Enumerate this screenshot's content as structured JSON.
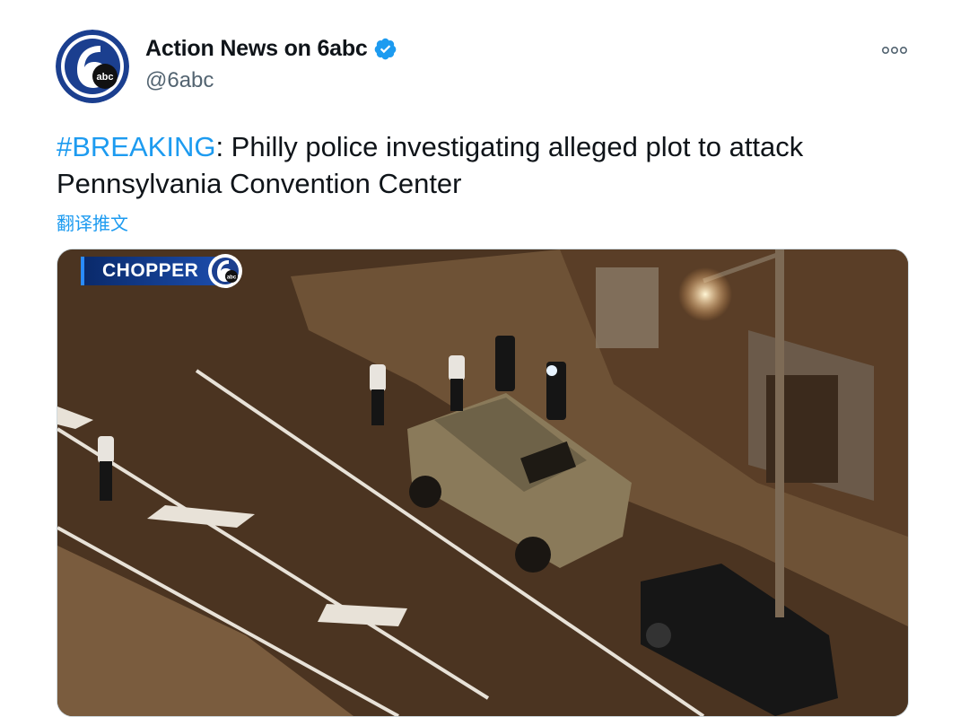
{
  "tweet": {
    "display_name": "Action News on 6abc",
    "handle": "@6abc",
    "verified": true,
    "avatar_icon": "6abc-logo-icon",
    "more_icon": "more-options-icon",
    "hashtag": "#BREAKING",
    "text_rest": ": Philly police investigating alleged plot to attack Pennsylvania Convention Center",
    "translate_label": "翻译推文"
  },
  "media": {
    "overlay_label": "CHOPPER",
    "overlay_logo_text": "abc"
  },
  "colors": {
    "link": "#1d9bf0",
    "text": "#0f1419",
    "secondary": "#536471",
    "badge_blue": "#1d4fb0"
  }
}
